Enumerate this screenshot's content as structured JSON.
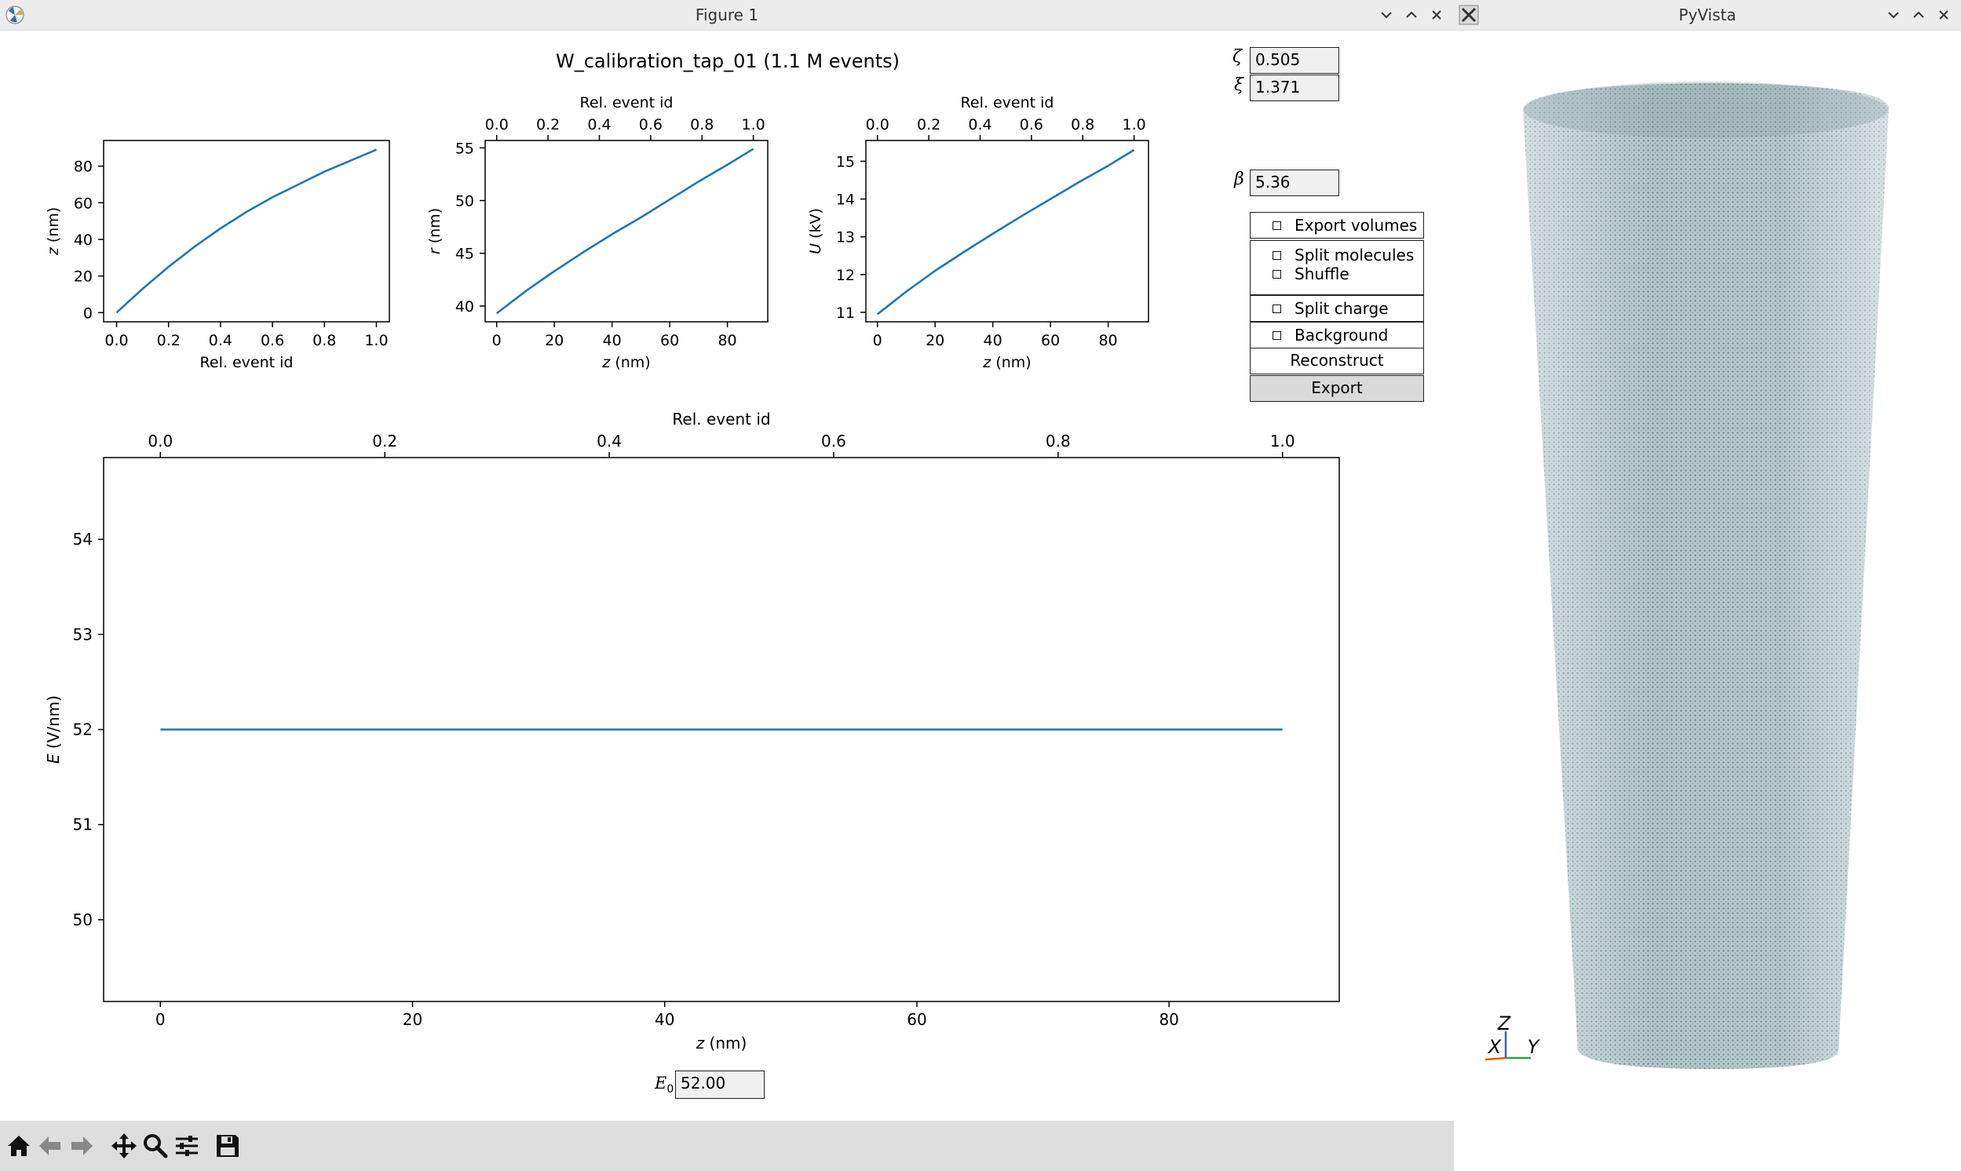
{
  "figure_window": {
    "title": "Figure 1",
    "controls": [
      "minimize-icon",
      "maximize-icon",
      "close-icon"
    ]
  },
  "pyvista_window": {
    "title": "PyVista",
    "controls": [
      "minimize-icon",
      "maximize-icon",
      "close-icon"
    ],
    "axes": {
      "z": "Z",
      "x": "X",
      "y": "Y"
    },
    "point_color": "#5f7f86"
  },
  "suptitle": "W_calibration_tap_01 (1.1 M events)",
  "params": {
    "zeta": {
      "symbol": "ζ",
      "value": "0.505"
    },
    "xi": {
      "symbol": "ξ",
      "value": "1.371"
    },
    "beta": {
      "symbol": "β",
      "value": "5.36"
    },
    "e0": {
      "symbol": "E",
      "sub": "0",
      "value": "52.00"
    }
  },
  "checks": {
    "export_volumes": "Export volumes",
    "split_molecules": "Split molecules",
    "shuffle": "Shuffle",
    "split_charge": "Split charge",
    "background": "Background"
  },
  "buttons": {
    "reconstruct": "Reconstruct",
    "export": "Export"
  },
  "toolbar": [
    "home-icon",
    "back-icon",
    "forward-icon",
    "pan-icon",
    "zoom-icon",
    "configure-icon",
    "save-icon"
  ],
  "chart_data": [
    {
      "type": "line",
      "xlabel": "Rel. event id",
      "ylabel": "z (nm)",
      "x": [
        0.0,
        0.1,
        0.2,
        0.3,
        0.4,
        0.5,
        0.6,
        0.7,
        0.8,
        0.9,
        1.0
      ],
      "y": [
        0,
        13,
        25,
        36,
        46,
        55,
        63,
        70,
        77,
        83,
        89
      ],
      "xlim": [
        -0.05,
        1.05
      ],
      "ylim": [
        -5,
        94
      ],
      "xticks": [
        "0.0",
        "0.2",
        "0.4",
        "0.6",
        "0.8",
        "1.0"
      ],
      "yticks": [
        "0",
        "20",
        "40",
        "60",
        "80"
      ],
      "color": "#1f77b4"
    },
    {
      "type": "line",
      "xlabel": "z (nm)",
      "ylabel": "r (nm)",
      "top_xlabel": "Rel. event id",
      "x": [
        0,
        10,
        20,
        30,
        40,
        50,
        60,
        70,
        80,
        89
      ],
      "y": [
        39.3,
        41.4,
        43.3,
        45.1,
        46.8,
        48.4,
        50.1,
        51.8,
        53.4,
        54.9
      ],
      "xlim": [
        -4,
        94
      ],
      "ylim": [
        38.5,
        55.7
      ],
      "xticks": [
        "0",
        "20",
        "40",
        "60",
        "80"
      ],
      "yticks": [
        "40",
        "45",
        "50",
        "55"
      ],
      "top_xticks": [
        "0.0",
        "0.2",
        "0.4",
        "0.6",
        "0.8",
        "1.0"
      ],
      "color": "#1f77b4"
    },
    {
      "type": "line",
      "xlabel": "z (nm)",
      "ylabel": "U (kV)",
      "top_xlabel": "Rel. event id",
      "x": [
        0,
        10,
        20,
        30,
        40,
        50,
        60,
        70,
        80,
        89
      ],
      "y": [
        10.95,
        11.55,
        12.1,
        12.6,
        13.08,
        13.55,
        14.0,
        14.45,
        14.88,
        15.3
      ],
      "xlim": [
        -4,
        94
      ],
      "ylim": [
        10.75,
        15.55
      ],
      "xticks": [
        "0",
        "20",
        "40",
        "60",
        "80"
      ],
      "yticks": [
        "11",
        "12",
        "13",
        "14",
        "15"
      ],
      "top_xticks": [
        "0.0",
        "0.2",
        "0.4",
        "0.6",
        "0.8",
        "1.0"
      ],
      "color": "#1f77b4"
    },
    {
      "type": "line",
      "xlabel": "z (nm)",
      "ylabel": "E (V/nm)",
      "top_xlabel": "Rel. event id",
      "x": [
        0,
        89
      ],
      "y": [
        52.0,
        52.0
      ],
      "xlim": [
        -4.5,
        93.5
      ],
      "ylim": [
        49.14,
        54.86
      ],
      "xticks": [
        "0",
        "20",
        "40",
        "60",
        "80"
      ],
      "yticks": [
        "50",
        "51",
        "52",
        "53",
        "54"
      ],
      "top_xticks": [
        "0.0",
        "0.2",
        "0.4",
        "0.6",
        "0.8",
        "1.0"
      ],
      "color": "#1f77b4"
    }
  ]
}
